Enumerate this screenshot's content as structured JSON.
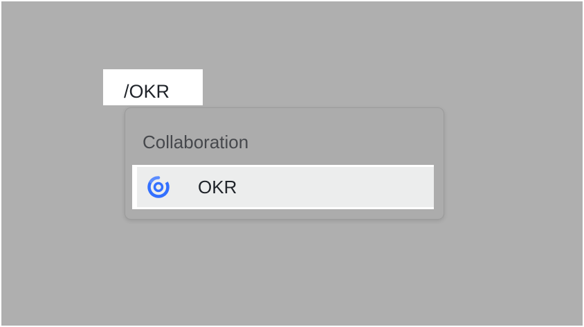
{
  "command": {
    "text": "/OKR"
  },
  "popover": {
    "group_label": "Collaboration",
    "items": [
      {
        "label": "OKR",
        "icon": "okr-icon",
        "icon_color": "#3370ff",
        "selected": true
      }
    ]
  },
  "colors": {
    "overlay": "#afafaf",
    "highlight": "#eceded",
    "accent": "#3370ff"
  }
}
